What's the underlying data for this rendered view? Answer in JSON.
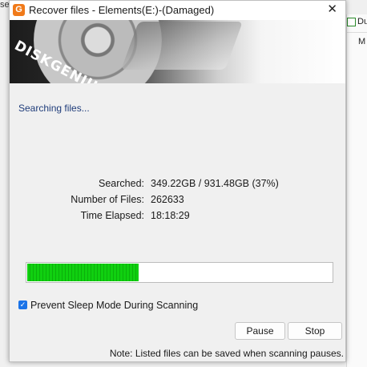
{
  "background": {
    "top_left_fragment": "ser",
    "right_column_header": "Du",
    "right_column_row": "M"
  },
  "dialog": {
    "app_icon_letter": "G",
    "title": "Recover files - Elements(E:)-(Damaged)",
    "close_glyph": "✕",
    "banner_brand": "DISKGENIUS",
    "status_text": "Searching files...",
    "stats": {
      "searched_label": "Searched:",
      "searched_value": "349.22GB / 931.48GB (37%)",
      "files_label": "Number of Files:",
      "files_value": "262633",
      "elapsed_label": "Time Elapsed:",
      "elapsed_value": "18:18:29"
    },
    "progress_fraction": 0.37,
    "prevent_sleep": {
      "checked": true,
      "check_glyph": "✓",
      "label": "Prevent Sleep Mode During Scanning"
    },
    "buttons": {
      "pause": "Pause",
      "stop": "Stop"
    },
    "note": "Note: Listed files can be saved when scanning pauses."
  },
  "colors": {
    "accent": "#1a73e8",
    "progress": "#10d010",
    "status_text": "#1f3c7a",
    "app_icon": "#f07a1a"
  }
}
